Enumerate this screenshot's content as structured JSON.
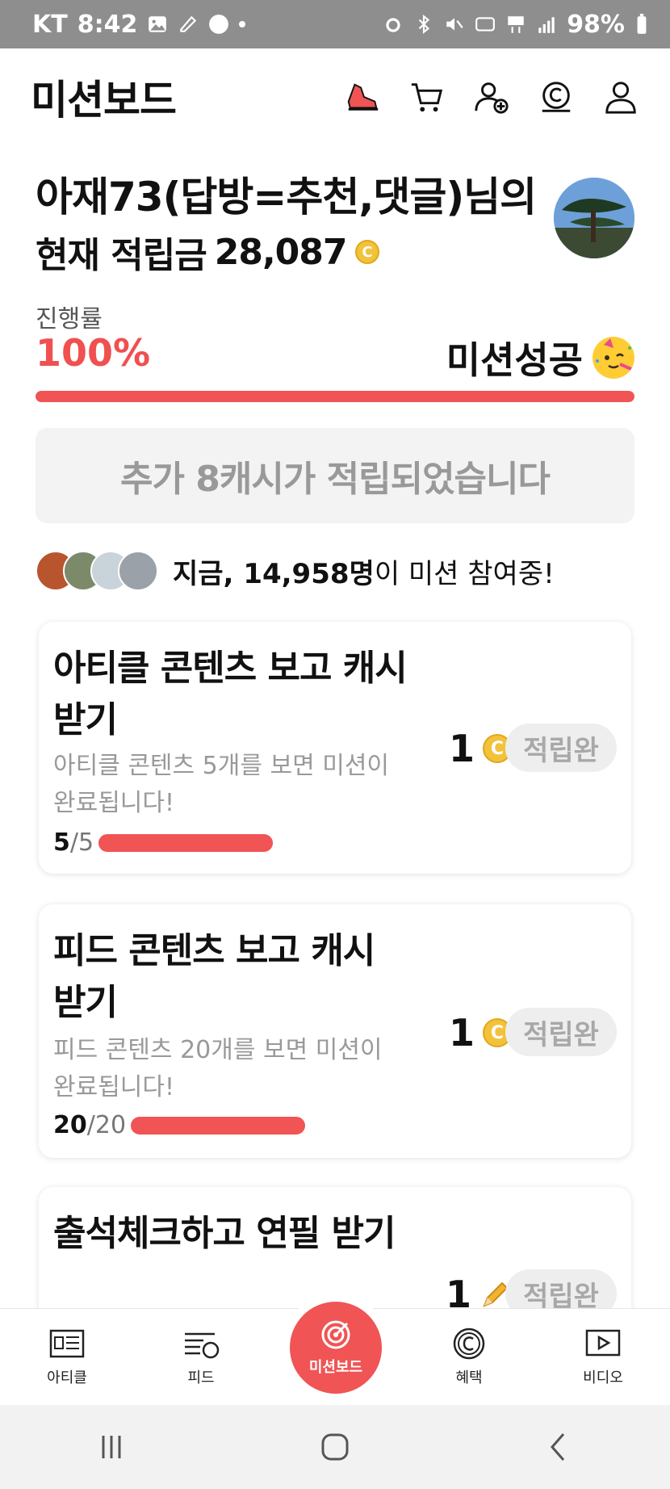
{
  "status_bar": {
    "carrier": "KT",
    "time": "8:42",
    "battery": "98%"
  },
  "header": {
    "title": "미션보드",
    "icons": [
      "shoe-icon",
      "cart-icon",
      "add-friend-icon",
      "cash-icon",
      "profile-icon"
    ]
  },
  "greeting": {
    "name_line": "아재73(답방=추천,댓글)님의",
    "balance_label": "현재 적립금",
    "balance_value": "28,087",
    "coin_symbol": "C"
  },
  "progress": {
    "label": "진행률",
    "percent_text": "100%",
    "fraction": 1.0,
    "status": "미션성공"
  },
  "extra_message": "추가 8캐시가 적립되었습니다",
  "participants": {
    "prefix": "지금,",
    "count": "14,958명",
    "suffix": "이 미션 참여중!"
  },
  "missions": [
    {
      "title": "아티클 콘텐츠 보고 캐시 받기",
      "description": "아티클 콘텐츠 5개를 보면 미션이 완료됩니다!",
      "done": "5",
      "total": "/5",
      "progress": 1.0,
      "reward": "1",
      "reward_icon": "coin-icon",
      "button": "적립완"
    },
    {
      "title": "피드 콘텐츠 보고 캐시 받기",
      "description": "피드 콘텐츠 20개를 보면 미션이 완료됩니다!",
      "done": "20",
      "total": "/20",
      "progress": 1.0,
      "reward": "1",
      "reward_icon": "coin-icon",
      "button": "적립완"
    },
    {
      "title": "출석체크하고 연필 받기",
      "reward": "1",
      "reward_icon": "pencil-icon",
      "button": "적립완"
    }
  ],
  "bottom_nav": {
    "items": [
      "아티클",
      "피드",
      "미션보드",
      "혜택",
      "비디오"
    ]
  },
  "colors": {
    "accent": "#f05454",
    "coin": "#f2c23a",
    "muted": "#999999"
  }
}
